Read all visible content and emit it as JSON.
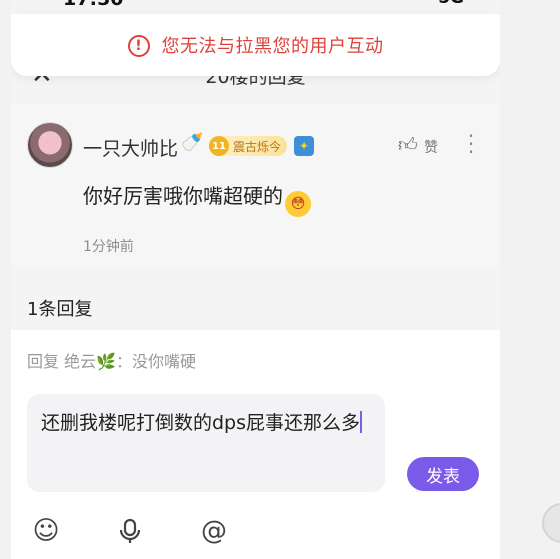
{
  "status": {
    "time": "17:50",
    "network": "5G"
  },
  "toast": {
    "icon": "!",
    "message": "您无法与拉黑您的用户互动"
  },
  "header": {
    "close_icon": "✕",
    "title": "20楼的回复"
  },
  "post": {
    "username": "一只大帅比",
    "bottle_icon": "🍼",
    "level_number": "11",
    "level_name": "震古烁今",
    "medal_icon": "✦",
    "like_label": "赞",
    "content": "你好厉害哦你嘴超硬的",
    "emoji_icon": "😳",
    "time": "1分钟前"
  },
  "replies": {
    "count_label": "1条回复"
  },
  "editor": {
    "reply_prefix": "回复 绝云",
    "reply_leaf": "🌿",
    "reply_quote": "：没你嘴硬",
    "input_text": "还删我楼呢打倒数的dps屁事还那么多",
    "send_label": "发表",
    "tools": [
      "emoji-icon",
      "microphone-icon",
      "mention-icon"
    ]
  }
}
